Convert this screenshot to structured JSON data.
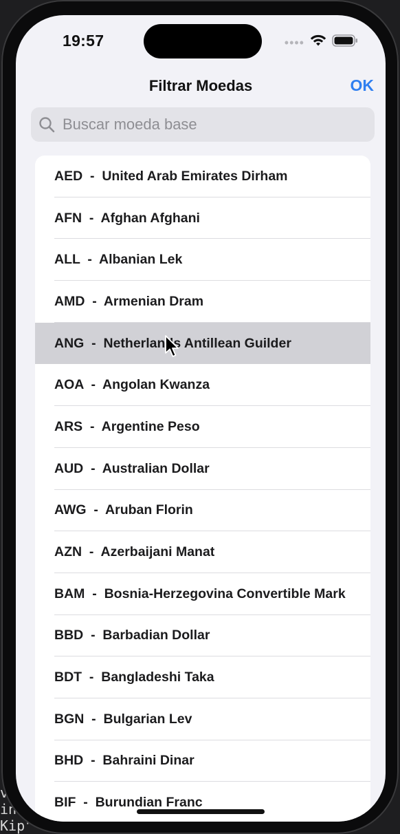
{
  "status_bar": {
    "time": "19:57",
    "signal_text": "••••"
  },
  "nav": {
    "title": "Filtrar Moedas",
    "ok_label": "OK",
    "accent_color": "#2f7ff0"
  },
  "search": {
    "placeholder": "Buscar moeda base",
    "value": ""
  },
  "currencies": [
    {
      "label": "AED  -  United Arab Emirates Dirham"
    },
    {
      "label": "AFN  -  Afghan Afghani"
    },
    {
      "label": "ALL  -  Albanian Lek"
    },
    {
      "label": "AMD  -  Armenian Dram"
    },
    {
      "label": "ANG  -  Netherlands Antillean Guilder"
    },
    {
      "label": "AOA  -  Angolan Kwanza"
    },
    {
      "label": "ARS  -  Argentine Peso"
    },
    {
      "label": "AUD  -  Australian Dollar"
    },
    {
      "label": "AWG  -  Aruban Florin"
    },
    {
      "label": "AZN  -  Azerbaijani Manat"
    },
    {
      "label": "BAM  -  Bosnia-Herzegovina Convertible Mark"
    },
    {
      "label": "BBD  -  Barbadian Dollar"
    },
    {
      "label": "BDT  -  Bangladeshi Taka"
    },
    {
      "label": "BGN  -  Bulgarian Lev"
    },
    {
      "label": "BHD  -  Bahraini Dinar"
    },
    {
      "label": "BIF  -  Burundian Franc"
    }
  ],
  "selected_index": 4,
  "background_code": [
    "v",
    "in",
    "Kip\""
  ]
}
